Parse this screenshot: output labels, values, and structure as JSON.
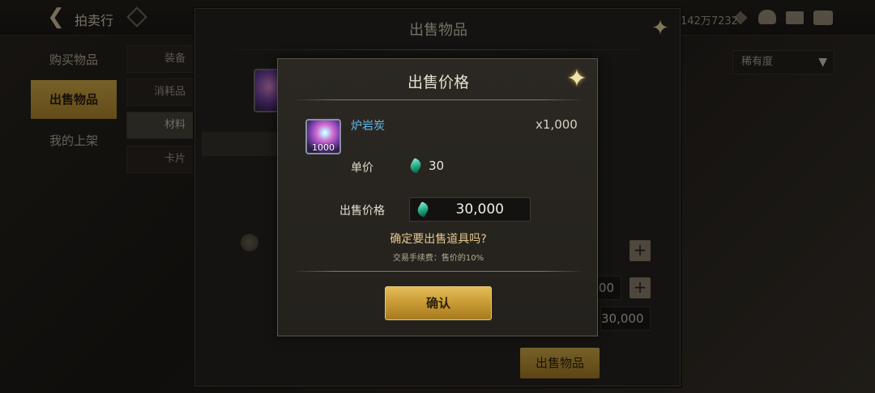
{
  "topbar": {
    "title": "拍卖行",
    "currency": "142万7232"
  },
  "left_tabs": [
    {
      "label": "购买物品"
    },
    {
      "label": "出售物品"
    },
    {
      "label": "我的上架"
    }
  ],
  "sub_tabs": [
    {
      "label": "装备"
    },
    {
      "label": "消耗品"
    },
    {
      "label": "材料"
    },
    {
      "label": "卡片"
    }
  ],
  "sell_panel": {
    "title": "出售物品",
    "rarity_filter": "稀有度",
    "total_field": "30,000",
    "qty_field": "1,000",
    "sell_button": "出售物品"
  },
  "modal": {
    "title": "出售价格",
    "item_name": "炉岩炭",
    "item_count": "1000",
    "quantity": "x1,000",
    "unit_price_label": "单价",
    "unit_price": "30",
    "sell_price_label": "出售价格",
    "sell_price": "30,000",
    "question": "确定要出售道具吗?",
    "fee_note": "交易手续费：售价的10%",
    "confirm_label": "确认",
    "item_name_color": "#5fb8ea",
    "accent_color": "#d8b14c"
  },
  "icons": {
    "back": "back-arrow-icon",
    "close": "close-star-icon",
    "currency": "diamond-icon",
    "gem": "green-gem-icon"
  }
}
